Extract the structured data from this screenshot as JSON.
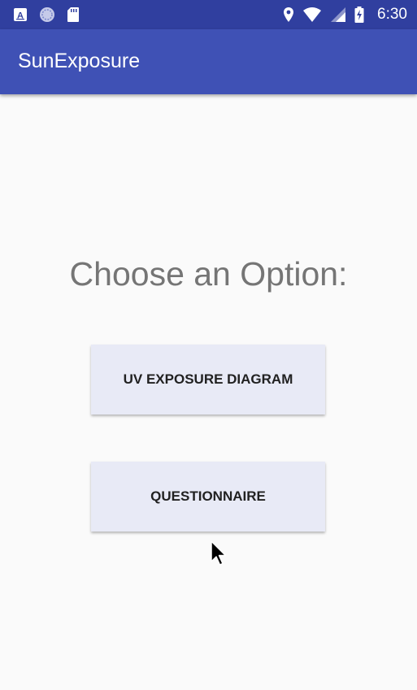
{
  "status_bar": {
    "time": "6:30",
    "icons": [
      "a-box-icon",
      "spinner-icon",
      "sd-card-icon",
      "location-icon",
      "wifi-icon",
      "cellular-icon",
      "battery-charging-icon"
    ]
  },
  "app_bar": {
    "title": "SunExposure"
  },
  "main": {
    "heading": "Choose an Option:",
    "buttons": [
      {
        "label": "UV EXPOSURE DIAGRAM"
      },
      {
        "label": "QUESTIONNAIRE"
      }
    ]
  },
  "colors": {
    "status_bar": "#303f9f",
    "app_bar": "#3f51b5",
    "button_bg": "#e8eaf6",
    "background": "#fafafa",
    "heading_text": "#757575"
  }
}
